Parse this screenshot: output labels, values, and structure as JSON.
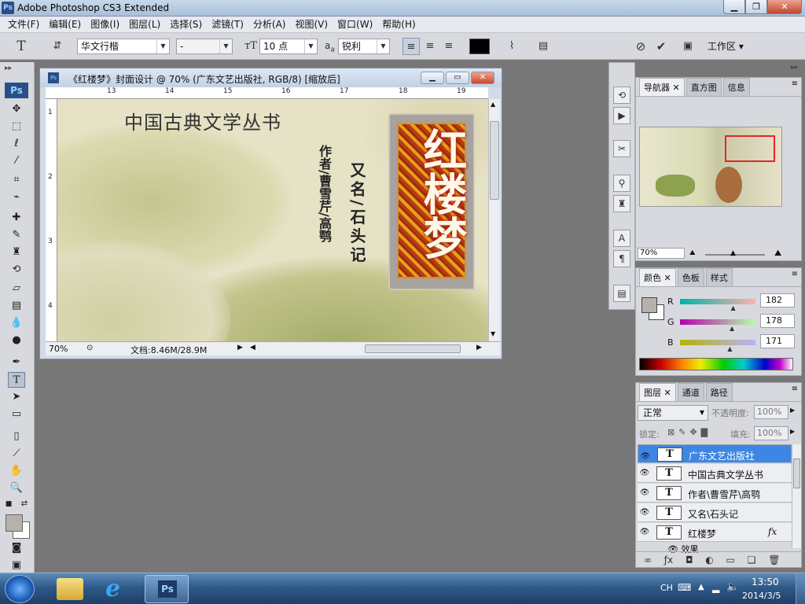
{
  "window": {
    "title": "Adobe Photoshop CS3 Extended",
    "app_icon": "Ps"
  },
  "menu": [
    "文件(F)",
    "编辑(E)",
    "图像(I)",
    "图层(L)",
    "选择(S)",
    "滤镜(T)",
    "分析(A)",
    "视图(V)",
    "窗口(W)",
    "帮助(H)"
  ],
  "options": {
    "font_family": "华文行楷",
    "font_style": "-",
    "font_size": "10 点",
    "antialias_label": "a",
    "antialias_prefix": "a",
    "antialias": "锐利",
    "workspace": "工作区",
    "text_color": "#000000"
  },
  "document": {
    "title": "《红楼梦》封面设计 @ 70% (广东文艺出版社, RGB/8) [缩放后]",
    "ruler_top": [
      "13",
      "14",
      "15",
      "16",
      "17",
      "18",
      "19"
    ],
    "ruler_left": [
      "1",
      "2",
      "3",
      "4"
    ],
    "zoom": "70%",
    "doc_info": "文档:8.46M/28.9M"
  },
  "canvas": {
    "series_title": "中国古典文学丛书",
    "author": "作者/曹雪芹/高鹗",
    "alias": "又名/石头记",
    "book_title": "红楼梦"
  },
  "navigator": {
    "tabs": [
      "导航器",
      "直方图",
      "信息"
    ],
    "zoom": "70%"
  },
  "color_panel": {
    "tabs": [
      "颜色",
      "色板",
      "样式"
    ],
    "channels": [
      {
        "label": "R",
        "value": "182",
        "fraction": 0.714
      },
      {
        "label": "G",
        "value": "178",
        "fraction": 0.698
      },
      {
        "label": "B",
        "value": "171",
        "fraction": 0.671
      }
    ],
    "foreground": "#b6b2ab",
    "background": "#ffffff"
  },
  "layers_panel": {
    "tabs": [
      "图层",
      "通道",
      "路径"
    ],
    "blend_mode": "正常",
    "opacity_label": "不透明度:",
    "opacity": "100%",
    "lock_label": "锁定:",
    "fill_label": "填充:",
    "fill": "100%",
    "layers": [
      {
        "name": "广东文艺出版社",
        "selected": true
      },
      {
        "name": "中国古典文学丛书",
        "selected": false
      },
      {
        "name": "作者\\曹雪芹\\高鹗",
        "selected": false
      },
      {
        "name": "又名\\石头记",
        "selected": false
      },
      {
        "name": "红楼梦",
        "selected": false,
        "fx": "fx"
      }
    ],
    "effects_label": "效果"
  },
  "taskbar": {
    "lang": "CH",
    "time": "13:50",
    "date": "2014/3/5",
    "ps_label": "Ps"
  }
}
